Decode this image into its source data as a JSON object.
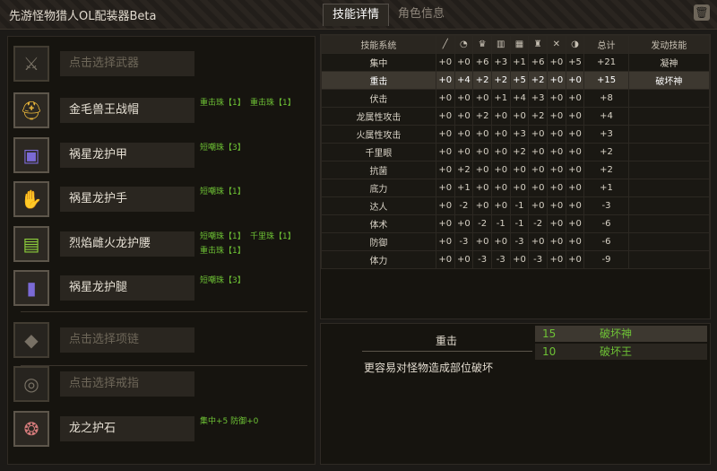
{
  "app": {
    "title": "先游怪物猎人OL配装器Beta"
  },
  "tabs": [
    {
      "label": "技能详情"
    },
    {
      "label": "角色信息"
    }
  ],
  "equipment": [
    {
      "label": "点击选择武器",
      "empty": true,
      "icon": "weapon-slot-icon",
      "tags": []
    },
    {
      "label": "金毛兽王战帽",
      "empty": false,
      "icon": "helmet-icon",
      "tags": [
        "重击珠【1】",
        "重击珠【1】"
      ]
    },
    {
      "label": "祸星龙护甲",
      "empty": false,
      "icon": "chest-armor-icon",
      "tags": [
        "短嘲珠【3】"
      ]
    },
    {
      "label": "祸星龙护手",
      "empty": false,
      "icon": "gauntlet-icon",
      "tags": [
        "短嘲珠【1】"
      ]
    },
    {
      "label": "烈焰雌火龙护腰",
      "empty": false,
      "icon": "waist-armor-icon",
      "tags": [
        "短嘲珠【1】",
        "千里珠【1】",
        "重击珠【1】"
      ]
    },
    {
      "label": "祸星龙护腿",
      "empty": false,
      "icon": "leg-armor-icon",
      "tags": [
        "短嘲珠【3】"
      ]
    },
    {
      "label": "点击选择项链",
      "empty": true,
      "icon": "necklace-slot-icon",
      "tags": []
    },
    {
      "label": "点击选择戒指",
      "empty": true,
      "icon": "ring-slot-icon",
      "tags": []
    },
    {
      "label": "龙之护石",
      "empty": false,
      "icon": "charm-icon",
      "tags": [
        "集中+5 防御+0"
      ]
    }
  ],
  "table": {
    "header_name": "技能系统",
    "header_total": "总计",
    "header_skill": "发动技能",
    "slot_icons": [
      "weapon-icon",
      "helmet-icon",
      "chest-icon",
      "arm-icon",
      "waist-icon",
      "leg-icon",
      "necklace-icon",
      "charm-icon"
    ],
    "rows": [
      {
        "name": "集中",
        "vals": [
          "+0",
          "+0",
          "+6",
          "+3",
          "+1",
          "+6",
          "+0",
          "+5"
        ],
        "total": "+21",
        "skill": "凝神",
        "selected": false
      },
      {
        "name": "重击",
        "vals": [
          "+0",
          "+4",
          "+2",
          "+2",
          "+5",
          "+2",
          "+0",
          "+0"
        ],
        "total": "+15",
        "skill": "破坏神",
        "selected": true
      },
      {
        "name": "伏击",
        "vals": [
          "+0",
          "+0",
          "+0",
          "+1",
          "+4",
          "+3",
          "+0",
          "+0"
        ],
        "total": "+8",
        "skill": "",
        "selected": false
      },
      {
        "name": "龙属性攻击",
        "vals": [
          "+0",
          "+0",
          "+2",
          "+0",
          "+0",
          "+2",
          "+0",
          "+0"
        ],
        "total": "+4",
        "skill": "",
        "selected": false
      },
      {
        "name": "火属性攻击",
        "vals": [
          "+0",
          "+0",
          "+0",
          "+0",
          "+3",
          "+0",
          "+0",
          "+0"
        ],
        "total": "+3",
        "skill": "",
        "selected": false
      },
      {
        "name": "千里眼",
        "vals": [
          "+0",
          "+0",
          "+0",
          "+0",
          "+2",
          "+0",
          "+0",
          "+0"
        ],
        "total": "+2",
        "skill": "",
        "selected": false
      },
      {
        "name": "抗菌",
        "vals": [
          "+0",
          "+2",
          "+0",
          "+0",
          "+0",
          "+0",
          "+0",
          "+0"
        ],
        "total": "+2",
        "skill": "",
        "selected": false
      },
      {
        "name": "底力",
        "vals": [
          "+0",
          "+1",
          "+0",
          "+0",
          "+0",
          "+0",
          "+0",
          "+0"
        ],
        "total": "+1",
        "skill": "",
        "selected": false
      },
      {
        "name": "达人",
        "vals": [
          "+0",
          "-2",
          "+0",
          "+0",
          "-1",
          "+0",
          "+0",
          "+0"
        ],
        "total": "-3",
        "skill": "",
        "selected": false
      },
      {
        "name": "体术",
        "vals": [
          "+0",
          "+0",
          "-2",
          "-1",
          "-1",
          "-2",
          "+0",
          "+0"
        ],
        "total": "-6",
        "skill": "",
        "selected": false
      },
      {
        "name": "防御",
        "vals": [
          "+0",
          "-3",
          "+0",
          "+0",
          "-3",
          "+0",
          "+0",
          "+0"
        ],
        "total": "-6",
        "skill": "",
        "selected": false
      },
      {
        "name": "体力",
        "vals": [
          "+0",
          "+0",
          "-3",
          "-3",
          "+0",
          "-3",
          "+0",
          "+0"
        ],
        "total": "-9",
        "skill": "",
        "selected": false
      }
    ]
  },
  "detail": {
    "title": "重击",
    "description": "更容易对怪物造成部位破坏",
    "requirements": [
      {
        "points": "15",
        "name": "破坏神",
        "highlight": true
      },
      {
        "points": "10",
        "name": "破坏王",
        "highlight": false
      }
    ]
  }
}
